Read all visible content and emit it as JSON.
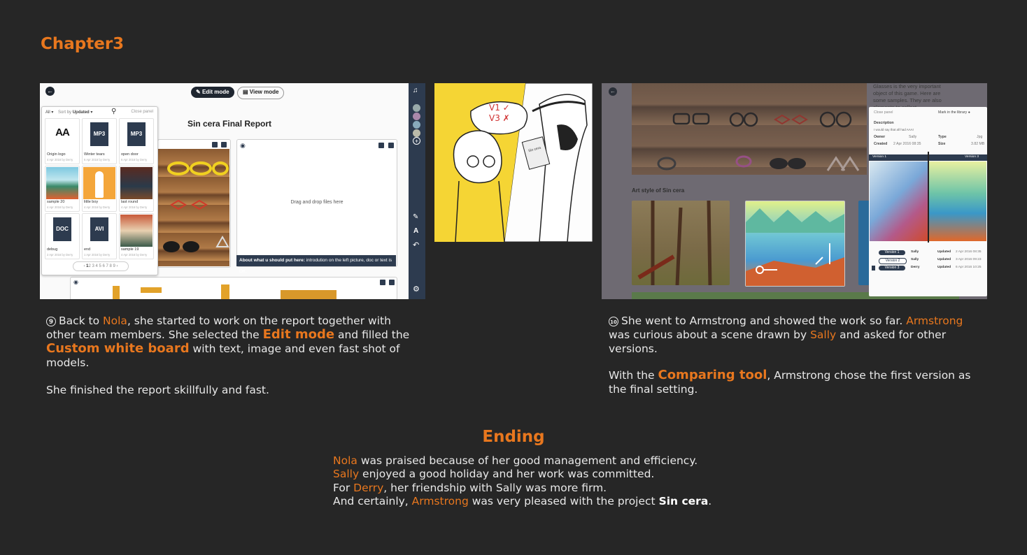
{
  "chapter_title": "Chapter3",
  "panel1": {
    "edit_mode_label": "Edit mode",
    "view_mode_label": "View mode",
    "report_title": "Sin cera Final Report",
    "filter_all": "All",
    "sort_prefix": "Sort by",
    "sort_value": "Updated",
    "close_panel": "Close panel",
    "drop_text": "Drag and drop files here",
    "drop_caption_bold": "About what u should put here:",
    "drop_caption_rest": " introdution on the left picture, doc or text is OK.",
    "pager_current": "1",
    "pager_rest": "2 3 4 5 6 7 8 9",
    "files": [
      {
        "name": "Origin logo",
        "meta": "4 Apr 2016 by Derry",
        "kind": "logo",
        "label": "AA"
      },
      {
        "name": "Winter tears",
        "meta": "6 Apr 2016 by Derry",
        "kind": "doc",
        "label": "MP3"
      },
      {
        "name": "open door",
        "meta": "6 Apr 2016 by Derry",
        "kind": "doc",
        "label": "MP3"
      },
      {
        "name": "sample 20",
        "meta": "4 Apr 2016 by Derry",
        "kind": "img1",
        "label": ""
      },
      {
        "name": "little boy",
        "meta": "4 Apr 2016 by Derry",
        "kind": "img2",
        "label": ""
      },
      {
        "name": "last round",
        "meta": "4 Apr 2016 by Derry",
        "kind": "img3",
        "label": ""
      },
      {
        "name": "debug",
        "meta": "2 Apr 2016 by Derry",
        "kind": "doc",
        "label": "DOC"
      },
      {
        "name": "end",
        "meta": "1 Apr 2016 by Derry",
        "kind": "doc",
        "label": "AVI"
      },
      {
        "name": "sample 19",
        "meta": "4 Apr 2016 by Derry",
        "kind": "img4",
        "label": ""
      }
    ],
    "sidebar_text_tool": "A"
  },
  "panel2": {
    "bubble_marks": "V1 ✓\nV3 ✗",
    "book_text": "Sin cera"
  },
  "panel3": {
    "bg_text": "Glasses is the very important object of this game. Here are some samples. They are also elements to collect",
    "art_style_label": "Art style of Sin cera",
    "close_panel": "Close panel",
    "mark_library": "Mark in the library",
    "description_label": "Description",
    "description_text": "I would say that all had AAA!",
    "owner_label": "Owner",
    "owner_value": "Sally",
    "type_label": "Type",
    "type_value": "Jpg",
    "created_label": "Created",
    "created_value": "2 Apr 2016 08:35",
    "size_label": "Size",
    "size_value": "3.82 MB",
    "compare_left": "Version 1",
    "compare_right": "Version 3",
    "versions": [
      {
        "label": "Version 1",
        "owner": "Sally",
        "status": "Updated",
        "date": "2 Apr 2016 08:35"
      },
      {
        "label": "Version 2",
        "owner": "Sally",
        "status": "Updated",
        "date": "3 Apr 2016 09:23"
      },
      {
        "label": "Version 3",
        "owner": "Derry",
        "status": "Updated",
        "date": "6 Apr 2016 10:25"
      }
    ]
  },
  "caption9": {
    "num": "9",
    "t1": "Back to ",
    "nola": "Nola",
    "t2": ", she started to work on the report together with other team members. She selected the ",
    "edit_mode": "Edit mode",
    "t3": " and filled the ",
    "custom_board": "Custom white board",
    "t4": " with text, image and even fast shot of models.",
    "p2": "She finished the report skillfully and fast."
  },
  "caption10": {
    "num": "10",
    "t1": "She went to Armstrong and showed the work so far. ",
    "armstrong": "Armstrong",
    "t2": " was curious about a scene drawn by ",
    "sally": "Sally",
    "t3": " and asked for other versions.",
    "p2a": "With the ",
    "comparing": "Comparing tool",
    "p2b": ", Armstrong chose the first version as the final setting."
  },
  "ending": {
    "title": "Ending",
    "l1_name": "Nola",
    "l1_rest": " was praised because of her good management and efficiency.",
    "l2_name": "Sally",
    "l2_rest": " enjoyed a good holiday and her work was committed.",
    "l3_pre": "For ",
    "l3_name": "Derry",
    "l3_rest": ", her friendship with Sally was more firm.",
    "l4_pre": "And certainly, ",
    "l4_name": "Armstrong",
    "l4_mid": " was very pleased with the project ",
    "l4_bold": "Sin cera",
    "l4_end": "."
  },
  "colors": {
    "accent": "#e8771e",
    "background": "#262626",
    "ui_dark": "#2d3b4f"
  }
}
